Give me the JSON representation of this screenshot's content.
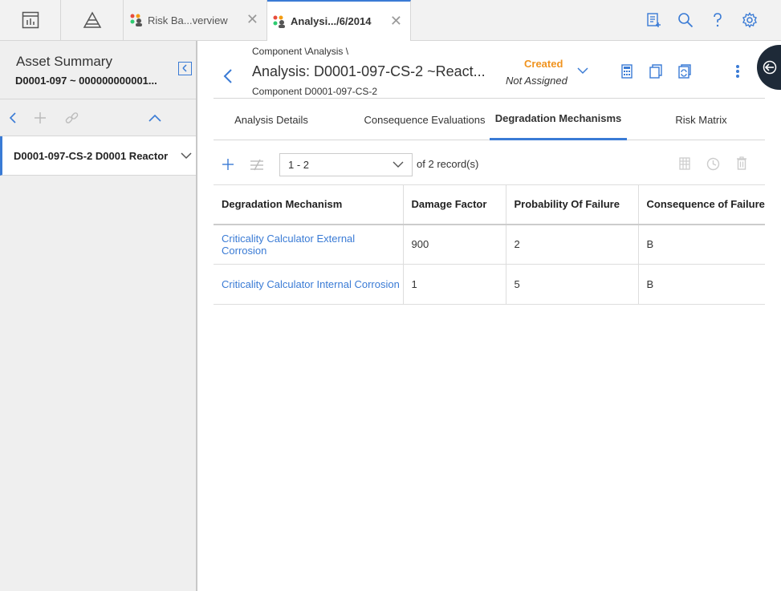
{
  "topbar": {
    "tabs": [
      {
        "label": "Risk Ba...verview",
        "icon": "users-colored-icon",
        "active": false
      },
      {
        "label": "Analysi.../6/2014",
        "icon": "users-colored-icon",
        "active": true
      }
    ]
  },
  "left_panel": {
    "title": "Asset Summary",
    "subtitle": "D0001-097 ~ 000000000001...",
    "tree_item": "D0001-097-CS-2 D0001 Reactor"
  },
  "header": {
    "breadcrumb": "Component \\Analysis \\",
    "title": "Analysis: D0001-097-CS-2 ~React...",
    "subtitle": "Component D0001-097-CS-2",
    "state": "Created",
    "assigned": "Not Assigned"
  },
  "subtabs": [
    {
      "label": "Analysis Details",
      "active": false
    },
    {
      "label": "Consequence Evaluations",
      "active": false
    },
    {
      "label": "Degradation Mechanisms",
      "active": true
    },
    {
      "label": "Risk Matrix",
      "active": false
    }
  ],
  "toolbar": {
    "range": "1 - 2",
    "of_label": "of",
    "total": "2",
    "records_label": "record(s)"
  },
  "table": {
    "columns": [
      "Degradation Mechanism",
      "Damage Factor",
      "Probability Of Failure",
      "Consequence of Failure"
    ],
    "rows": [
      [
        "Criticality Calculator External Corrosion",
        "900",
        "2",
        "B"
      ],
      [
        "Criticality Calculator Internal Corrosion",
        "1",
        "5",
        "B"
      ]
    ]
  },
  "colors": {
    "accent": "#3a7bd5",
    "state": "#f0931e",
    "float_button": "#1e2a38"
  }
}
